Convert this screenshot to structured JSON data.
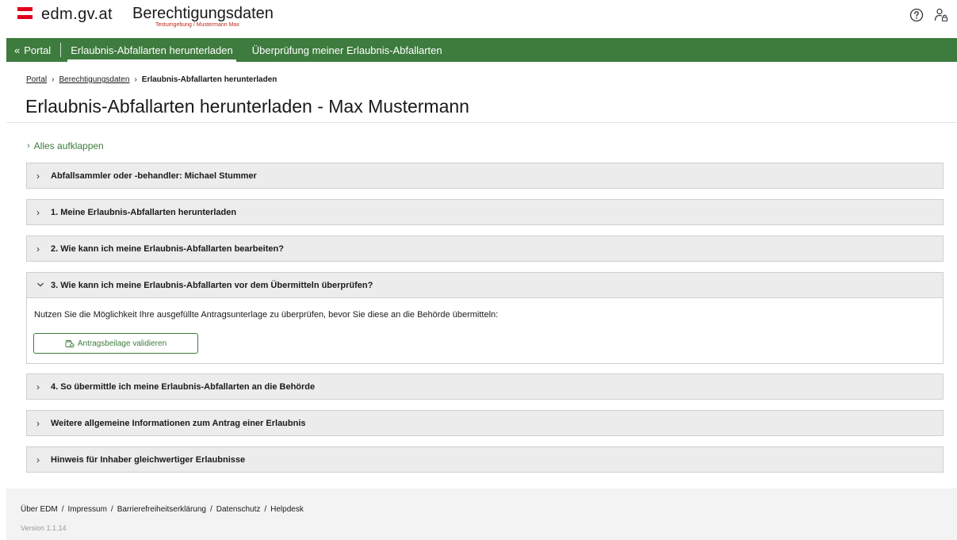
{
  "header": {
    "site_name": "edm.gv.at",
    "app_title": "Berechtigungsdaten",
    "app_subtitle": "Testumgebung / Mustermann Max",
    "flag_colors": [
      "#e2001a",
      "#ffffff",
      "#e2001a"
    ]
  },
  "nav": {
    "portal_label": "Portal",
    "items": [
      {
        "label": "Erlaubnis-Abfallarten herunterladen",
        "active": true
      },
      {
        "label": "Überprüfung meiner Erlaubnis-Abfallarten",
        "active": false
      }
    ]
  },
  "breadcrumb": {
    "items": [
      "Portal",
      "Berechtigungsdaten"
    ],
    "current": "Erlaubnis-Abfallarten herunterladen"
  },
  "page": {
    "title": "Erlaubnis-Abfallarten herunterladen - Max Mustermann",
    "expand_all": "Alles aufklappen"
  },
  "accordion": [
    {
      "title": "Abfallsammler oder -behandler: Michael Stummer",
      "expanded": false
    },
    {
      "title": "1. Meine Erlaubnis-Abfallarten herunterladen",
      "expanded": false
    },
    {
      "title": "2. Wie kann ich meine Erlaubnis-Abfallarten bearbeiten?",
      "expanded": false
    },
    {
      "title": "3. Wie kann ich meine Erlaubnis-Abfallarten vor dem Übermitteln überprüfen?",
      "expanded": true,
      "body_text": "Nutzen Sie die Möglichkeit Ihre ausgefüllte Antragsunterlage zu überprüfen, bevor Sie diese an die Behörde übermitteln:",
      "button_label": "Antragsbeilage validieren"
    },
    {
      "title": "4. So übermittle ich meine Erlaubnis-Abfallarten an die Behörde",
      "expanded": false
    },
    {
      "title": "Weitere allgemeine Informationen zum Antrag einer Erlaubnis",
      "expanded": false
    },
    {
      "title": "Hinweis für Inhaber gleichwertiger Erlaubnisse",
      "expanded": false
    }
  ],
  "footer": {
    "links": [
      "Über EDM",
      "Impressum",
      "Barrierefreiheitserklärung",
      "Datenschutz",
      "Helpdesk"
    ],
    "version": "Version 1.1.14"
  },
  "colors": {
    "brand_green": "#3e7b3e",
    "accordion_bg": "#ececec"
  },
  "icons": {
    "help": "help-circle-icon",
    "user": "user-icon",
    "validate": "check-document-icon"
  }
}
